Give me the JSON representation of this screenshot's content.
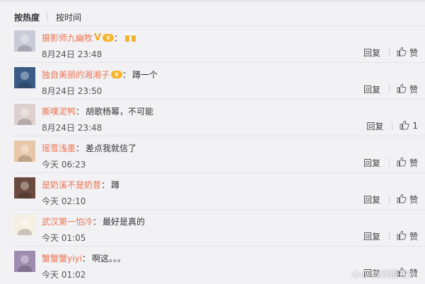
{
  "sort_tabs": {
    "by_hot": "按热度",
    "by_time": "按时间"
  },
  "comments": [
    {
      "user": "摄影师九幽牧",
      "verified": true,
      "vip": true,
      "text": "",
      "emoji": "beer-emoji",
      "time": "8月24日 23:48",
      "reply": "回复",
      "like": "赞",
      "avatar_color": "#c9ccd6"
    },
    {
      "user": "独自美丽的湘湘子",
      "verified": false,
      "vip": true,
      "text": "蹲一个",
      "emoji": "",
      "time": "8月24日 23:50",
      "reply": "回复",
      "like": "赞",
      "avatar_color": "#3a5b86"
    },
    {
      "user": "撕噗泥鸭",
      "verified": false,
      "vip": false,
      "text": "胡歌杨幂，不可能",
      "emoji": "",
      "time": "8月24日 23:48",
      "reply": "回复",
      "like": "1",
      "avatar_color": "#ddd0cf"
    },
    {
      "user": "瑶雪浅墨",
      "verified": false,
      "vip": false,
      "text": "差点我就信了",
      "emoji": "",
      "time": "今天 06:23",
      "reply": "回复",
      "like": "赞",
      "avatar_color": "#e8c6a8"
    },
    {
      "user": "是奶溪不是奶昔",
      "verified": false,
      "vip": false,
      "text": "蹲",
      "emoji": "",
      "time": "今天 02:10",
      "reply": "回复",
      "like": "赞",
      "avatar_color": "#6b4a3f"
    },
    {
      "user": "武汉第一怕冷",
      "verified": false,
      "vip": false,
      "text": "最好是真的",
      "emoji": "",
      "time": "今天 01:05",
      "reply": "回复",
      "like": "赞",
      "avatar_color": "#f4f0e2"
    },
    {
      "user": "蟹蟹蟹yiyi",
      "verified": false,
      "vip": false,
      "text": "啊这。。。",
      "emoji": "",
      "time": "今天 01:02",
      "reply": "回复",
      "like": "赞",
      "avatar_color": "#9e8bb0"
    }
  ],
  "colon": "：",
  "watermark": "心心 娱乐最在外"
}
